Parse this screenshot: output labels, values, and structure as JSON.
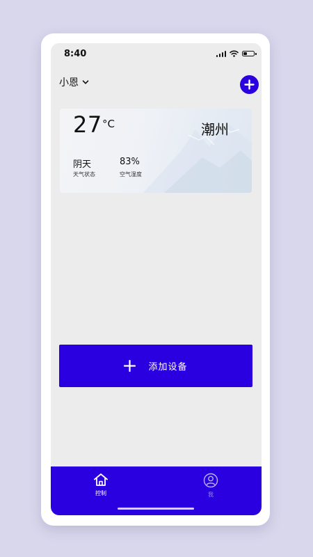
{
  "status_bar": {
    "time": "8:40",
    "battery_level": 0.35
  },
  "header": {
    "home_name": "小恩",
    "dropdown_icon": "chevron-down-icon",
    "add_icon": "plus-circle-icon"
  },
  "weather": {
    "temperature": "27",
    "unit": "°C",
    "city": "潮州",
    "condition_value": "阴天",
    "condition_label": "天气状态",
    "humidity_value": "83%",
    "humidity_label": "空气湿度"
  },
  "add_device": {
    "label": "添加设备",
    "icon": "plus-icon"
  },
  "tabbar": {
    "tabs": [
      {
        "label": "控制",
        "icon": "home-icon",
        "active": true
      },
      {
        "label": "我",
        "icon": "user-icon",
        "active": false
      }
    ]
  },
  "colors": {
    "accent": "#2a00e0",
    "background": "#ececec",
    "frame_bg": "#d9d7ec"
  }
}
